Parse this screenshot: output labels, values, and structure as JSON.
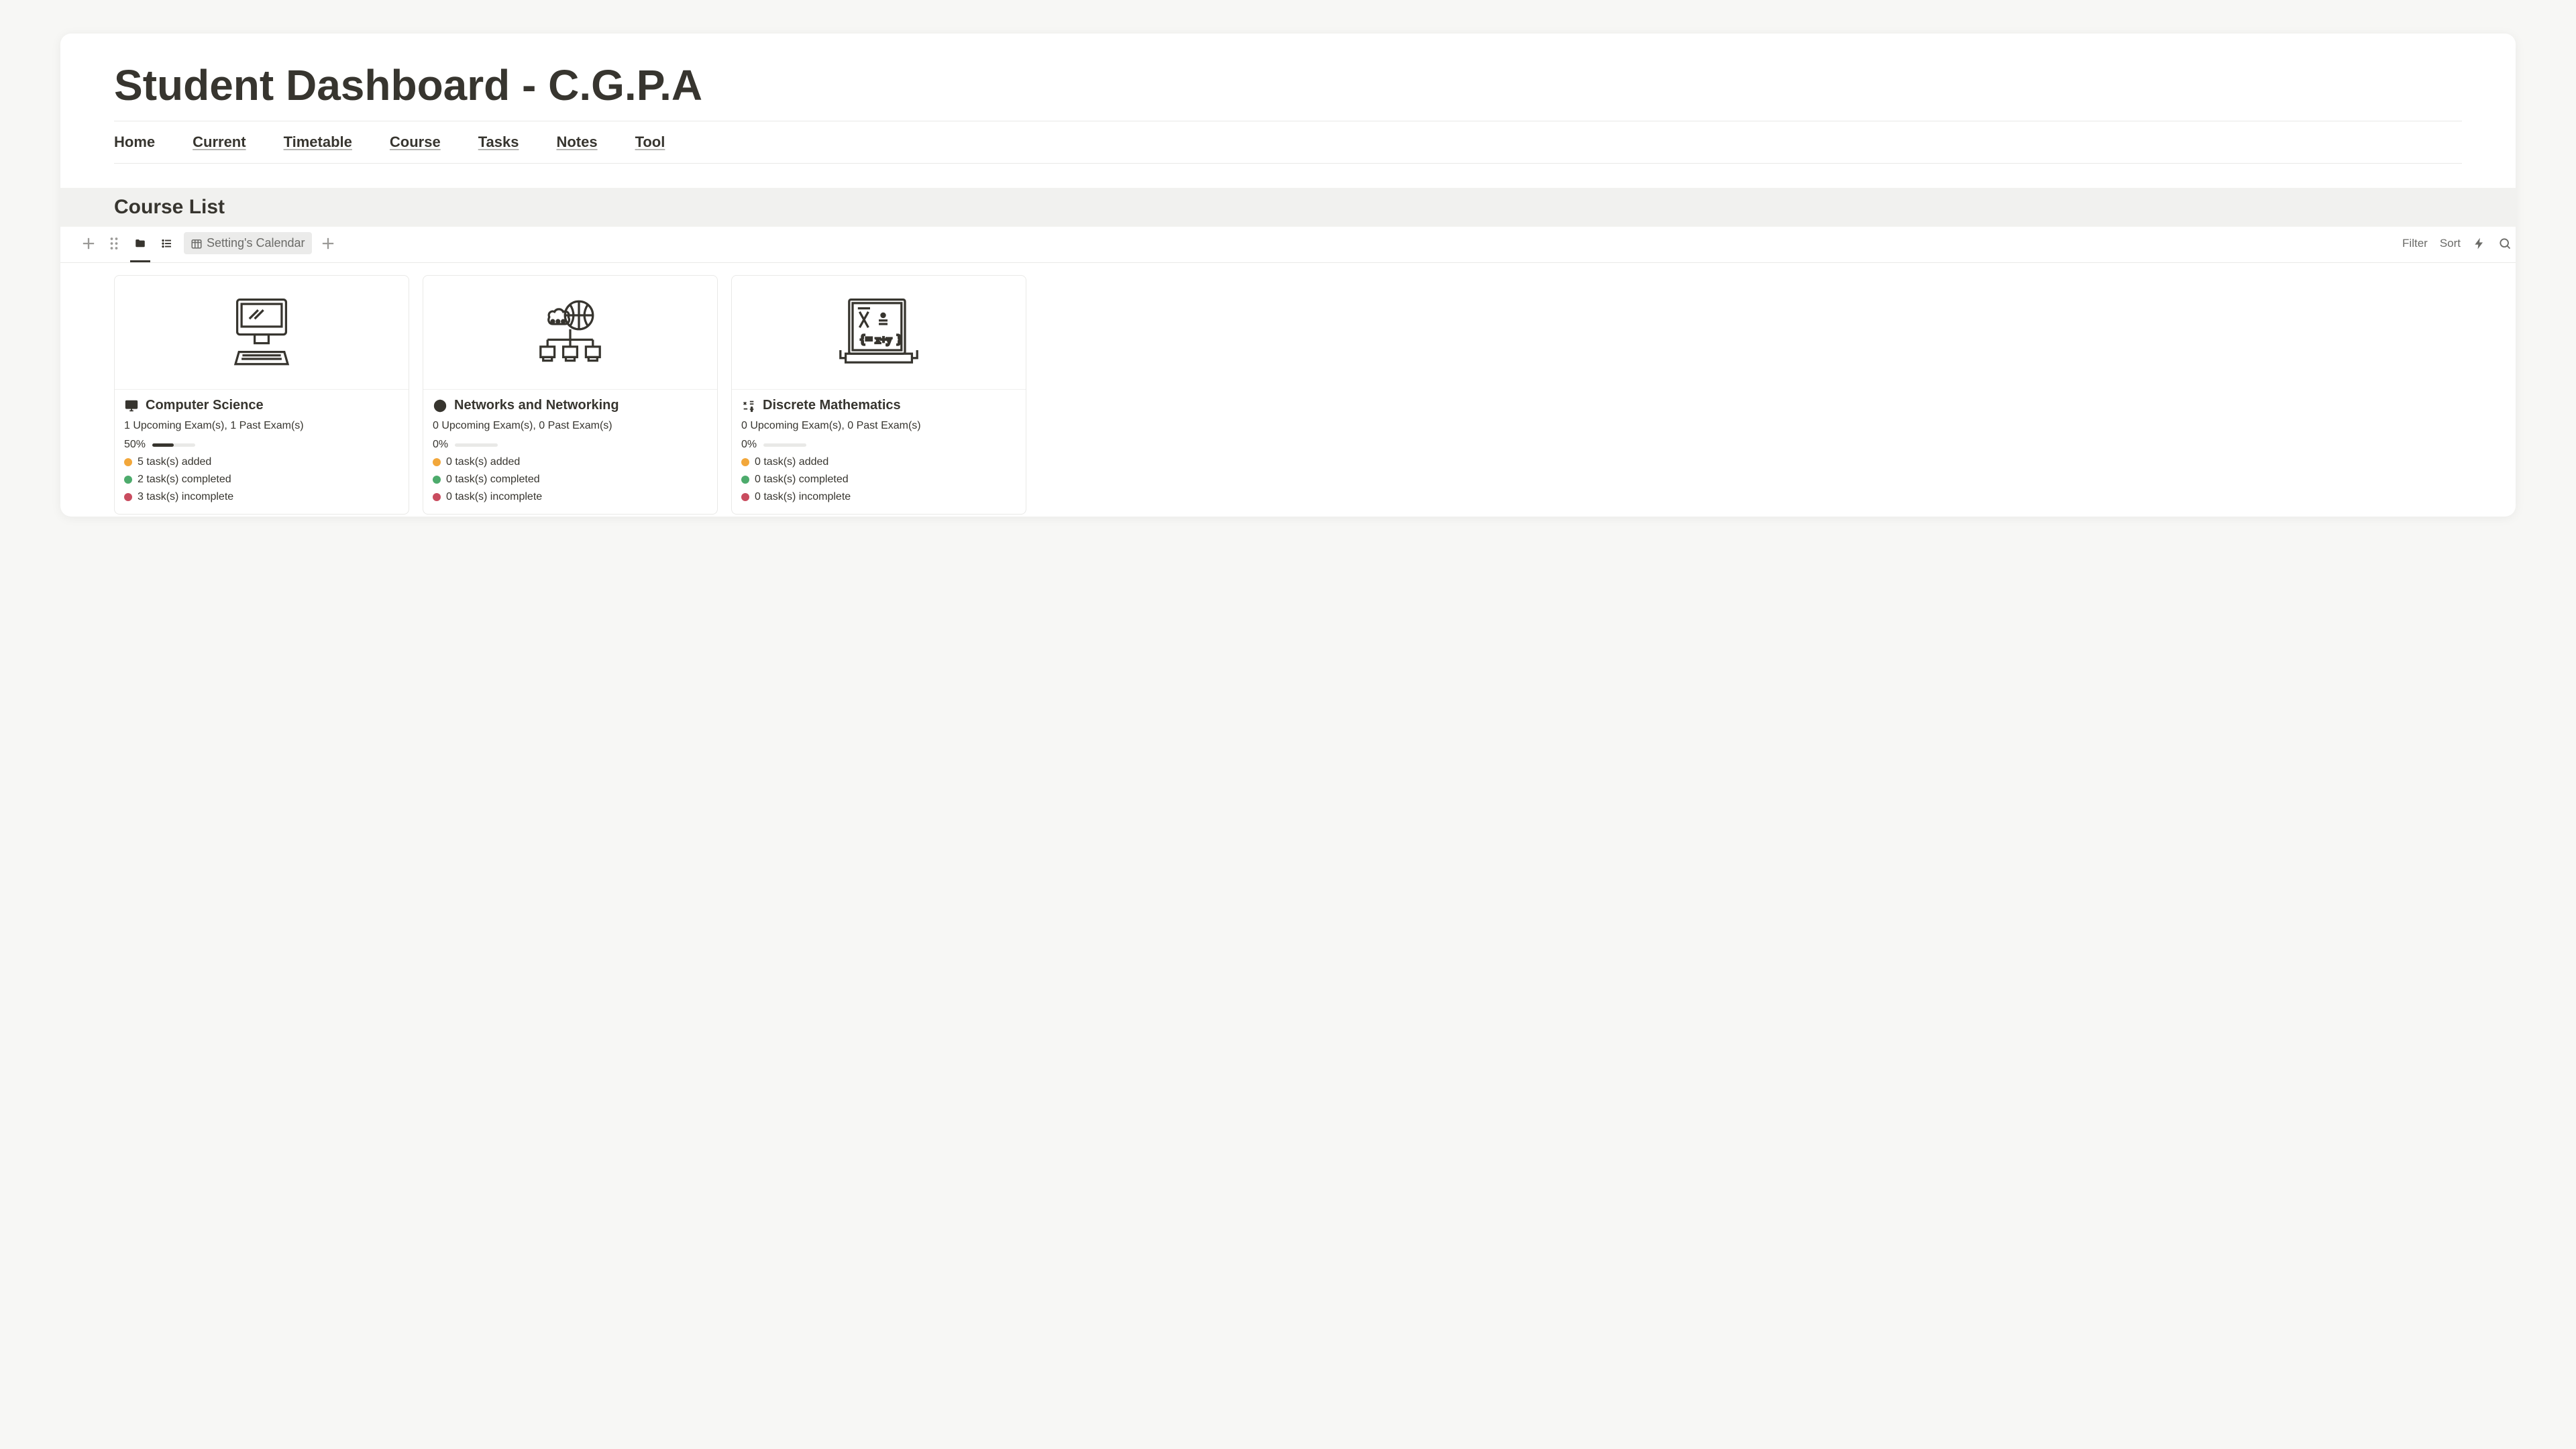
{
  "page_title": "Student Dashboard - C.G.P.A",
  "nav": [
    "Home",
    "Current",
    "Timetable",
    "Course",
    "Tasks",
    "Notes",
    "Tool"
  ],
  "section_title": "Course List",
  "views": {
    "calendar_label": "Setting's Calendar"
  },
  "controls": {
    "filter": "Filter",
    "sort": "Sort"
  },
  "courses": [
    {
      "title": "Computer Science",
      "exams": "1 Upcoming Exam(s), 1 Past Exam(s)",
      "pct": "50%",
      "pct_val": 50,
      "added": "5 task(s) added",
      "completed": "2 task(s) completed",
      "incomplete": "3 task(s) incomplete"
    },
    {
      "title": "Networks and Networking",
      "exams": "0 Upcoming Exam(s), 0 Past Exam(s)",
      "pct": "0%",
      "pct_val": 0,
      "added": "0 task(s) added",
      "completed": "0 task(s) completed",
      "incomplete": "0 task(s) incomplete"
    },
    {
      "title": "Discrete Mathematics",
      "exams": "0 Upcoming Exam(s), 0 Past Exam(s)",
      "pct": "0%",
      "pct_val": 0,
      "added": "0 task(s) added",
      "completed": "0 task(s) completed",
      "incomplete": "0 task(s) incomplete"
    }
  ]
}
